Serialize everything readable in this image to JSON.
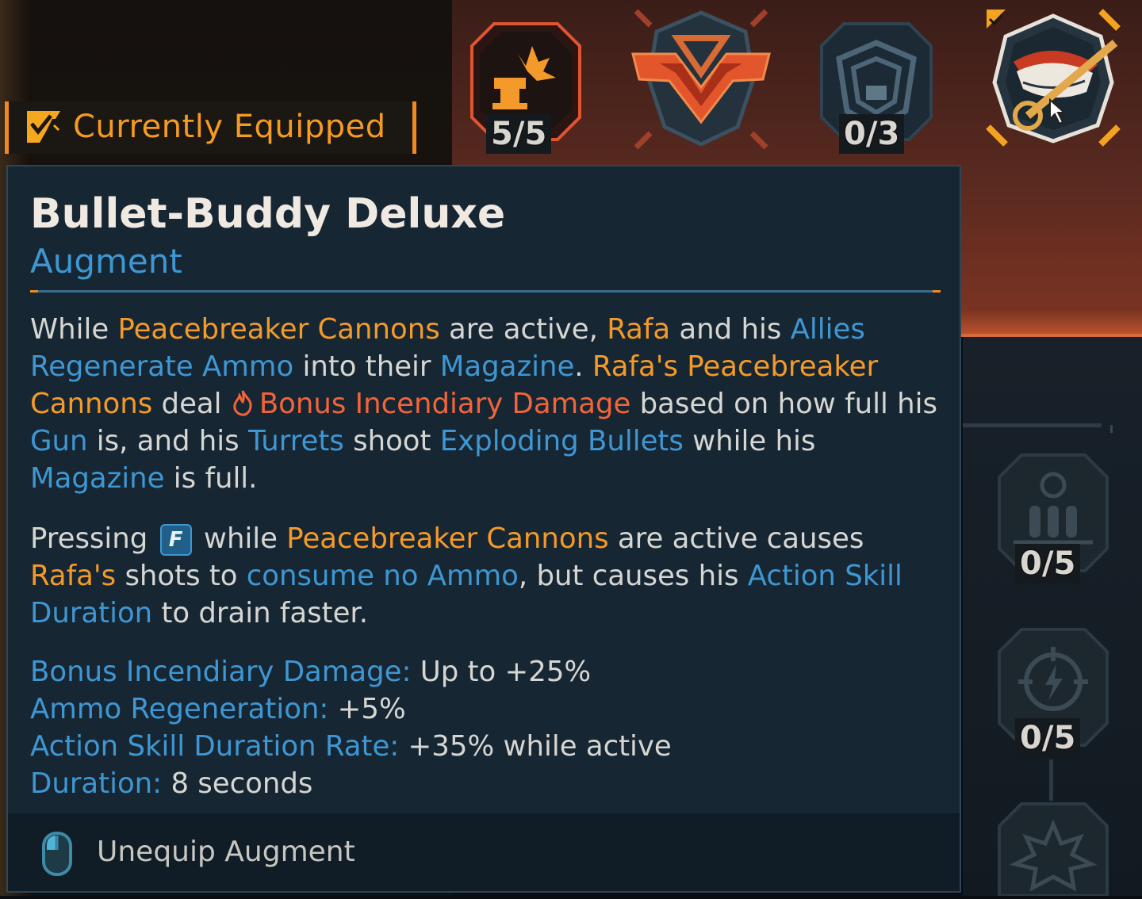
{
  "header": {
    "equipped_label": "Currently Equipped"
  },
  "nodes": [
    {
      "id": "turret",
      "icon": "turret-burst-icon",
      "counter": "5/5"
    },
    {
      "id": "emblem",
      "icon": "chevron-emblem-icon"
    },
    {
      "id": "shield",
      "icon": "shield-icon",
      "counter": "0/3"
    },
    {
      "id": "augment",
      "icon": "grin-wrench-icon",
      "selected": true
    }
  ],
  "side_nodes": [
    {
      "icon": "biohazard-ammo-icon",
      "counter": "0/5"
    },
    {
      "icon": "crosshair-lightning-icon",
      "counter": "0/5"
    },
    {
      "icon": "explosion-icon"
    }
  ],
  "tooltip": {
    "title": "Bullet-Buddy Deluxe",
    "subtitle": "Augment",
    "p1": {
      "t1": "While ",
      "t2": "Peacebreaker Cannons",
      "t3": " are active, ",
      "t4": "Rafa",
      "t5": " and his ",
      "t6": "Allies Regenerate Ammo",
      "t7": " into their ",
      "t8": "Magazine",
      "t9": ". ",
      "t10": "Rafa's Peacebreaker Cannons",
      "t11": " deal ",
      "t12": "Bonus Incendiary Damage",
      "t13": " based on how full his ",
      "t14": "Gun",
      "t15": " is, and his ",
      "t16": "Turrets",
      "t17": " shoot ",
      "t18": "Exploding Bullets",
      "t19": " while his ",
      "t20": "Magazine",
      "t21": " is full."
    },
    "p2": {
      "t1": "Pressing ",
      "key": "F",
      "t2": " while ",
      "t3": "Peacebreaker Cannons",
      "t4": " are active causes ",
      "t5": "Rafa's",
      "t6": " shots to ",
      "t7": "consume no Ammo",
      "t8": ", but causes his ",
      "t9": "Action Skill Duration",
      "t10": " to drain faster."
    },
    "stats": [
      {
        "label": "Bonus Incendiary Damage:",
        "value": " Up to +25%"
      },
      {
        "label": "Ammo Regeneration:",
        "value": " +5%"
      },
      {
        "label": "Action Skill Duration Rate:",
        "value": " +35% while active"
      },
      {
        "label": "Duration:",
        "value": " 8 seconds"
      }
    ],
    "footer": {
      "icon": "mouse-icon",
      "action_label": "Unequip Augment"
    }
  },
  "colors": {
    "orange": "#f49a28",
    "blue": "#3e97d3",
    "red": "#f2643a",
    "panel": "#172633"
  }
}
